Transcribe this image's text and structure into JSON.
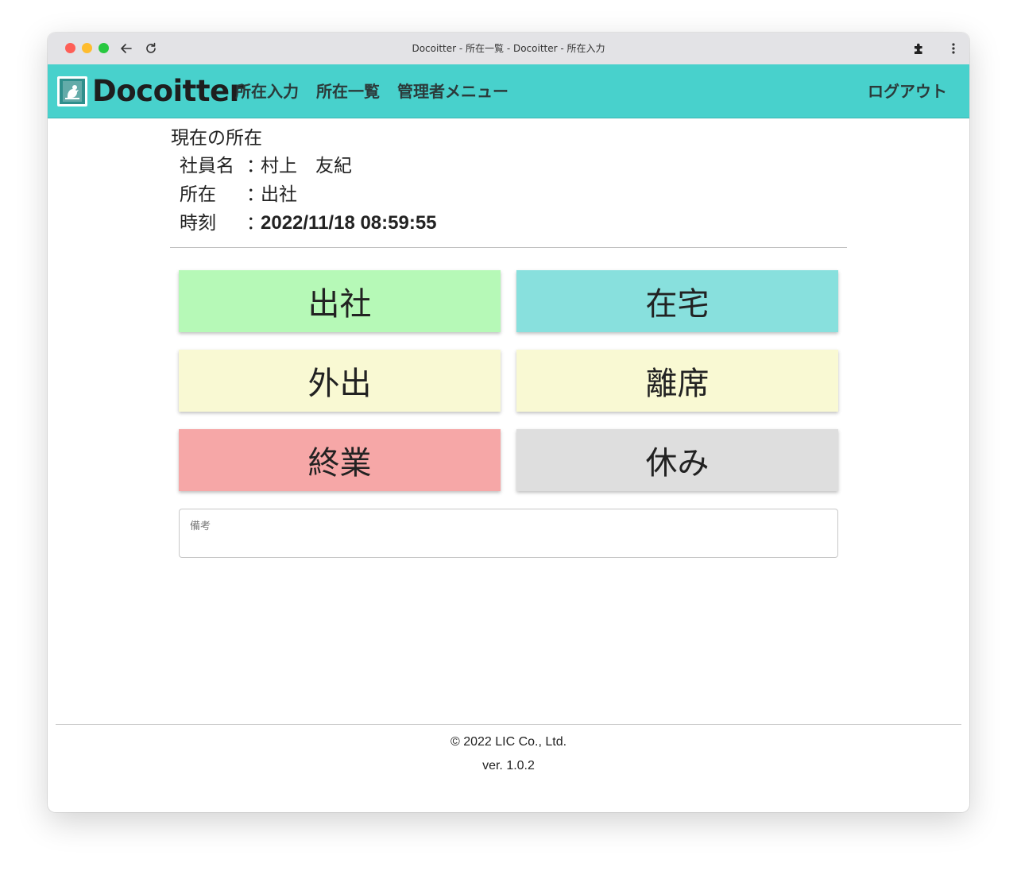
{
  "window": {
    "title": "Docoitter - 所在一覧 - Docoitter - 所在入力"
  },
  "navbar": {
    "brand": "Docoitter",
    "links": [
      "所在入力",
      "所在一覧",
      "管理者メニュー"
    ],
    "logout": "ログアウト",
    "color": "#48d1cc"
  },
  "status": {
    "heading": "現在の所在",
    "name_label": "社員名",
    "name_value": "村上　友紀",
    "location_label": "所在",
    "location_value": "出社",
    "time_label": "時刻",
    "time_value": "2022/11/18 08:59:55",
    "colon": "："
  },
  "buttons": [
    {
      "label": "出社",
      "color": "#b6f9b7"
    },
    {
      "label": "在宅",
      "color": "#88e0dd"
    },
    {
      "label": "外出",
      "color": "#f9f9d3"
    },
    {
      "label": "離席",
      "color": "#f9f9d3"
    },
    {
      "label": "終業",
      "color": "#f6a7a7"
    },
    {
      "label": "休み",
      "color": "#dedede"
    }
  ],
  "memo": {
    "label": "備考",
    "value": ""
  },
  "footer": {
    "copyright": "© 2022 LIC Co., Ltd.",
    "version": "ver. 1.0.2"
  }
}
